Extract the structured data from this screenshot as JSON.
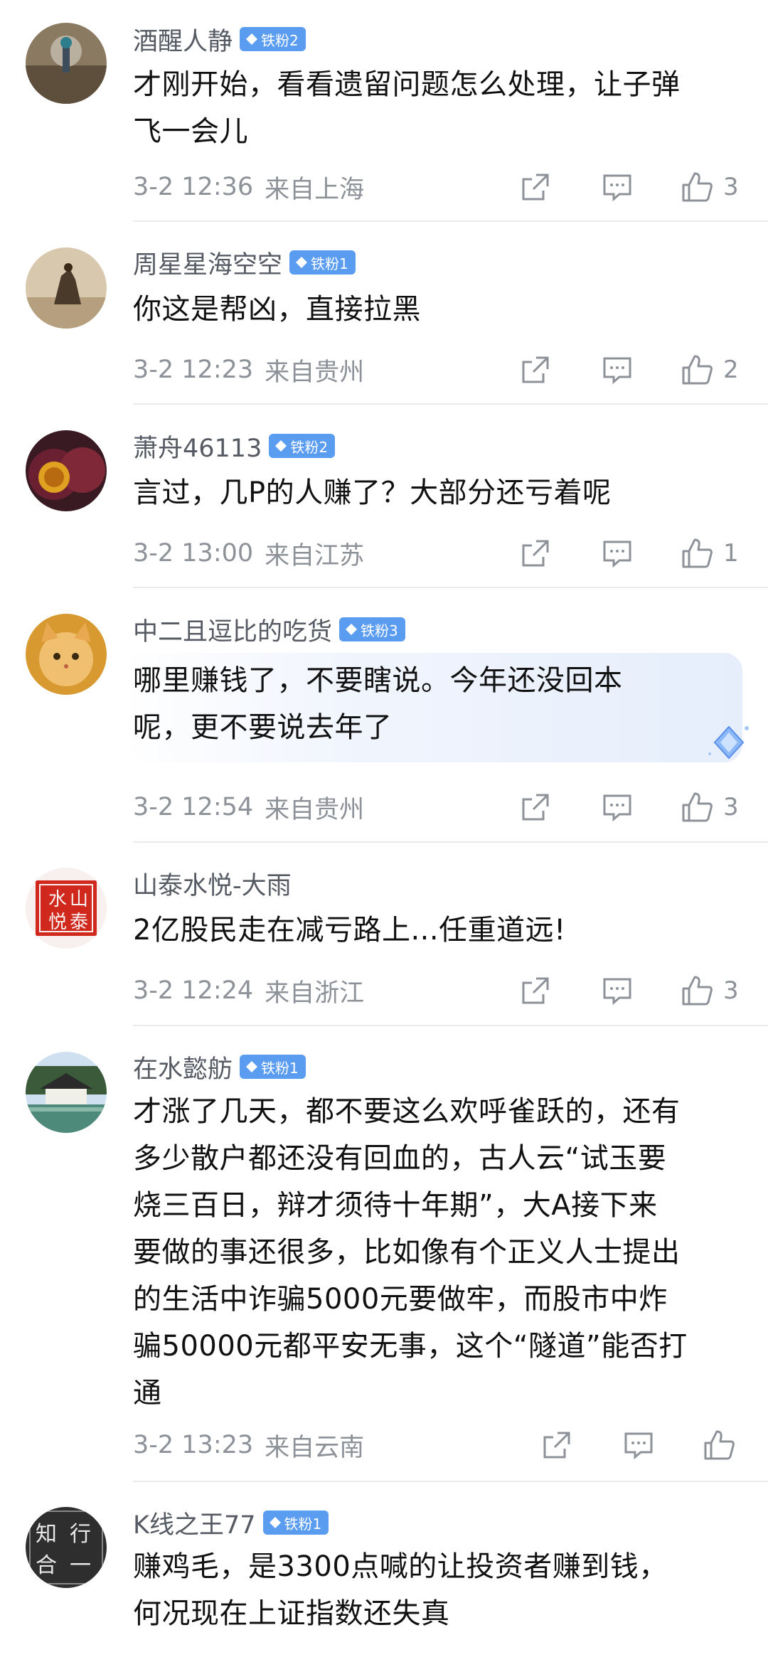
{
  "comments": [
    {
      "username": "酒醒人静",
      "badge": "铁粉2",
      "lines": [
        "才刚开始，看看遗留问题怎么处理，让子弹",
        "飞一会儿"
      ],
      "time": "3-2 12:36",
      "location": "来自上海",
      "likes": "3"
    },
    {
      "username": "周星星海空空",
      "badge": "铁粉1",
      "lines": [
        "你这是帮凶，直接拉黑"
      ],
      "time": "3-2 12:23",
      "location": "来自贵州",
      "likes": "2"
    },
    {
      "username": "萧舟46113",
      "badge": "铁粉2",
      "lines": [
        "言过，几P的人赚了？大部分还亏着呢"
      ],
      "time": "3-2 13:00",
      "location": "来自江苏",
      "likes": "1"
    },
    {
      "username": "中二且逗比的吃货",
      "badge": "铁粉3",
      "lines": [
        "哪里赚钱了，不要瞎说。今年还没回本",
        "呢，更不要说去年了"
      ],
      "time": "3-2 12:54",
      "location": "来自贵州",
      "likes": "3"
    },
    {
      "username": "山泰水悦-大雨",
      "badge": "",
      "lines": [
        "2亿股民走在减亏路上...任重道远!"
      ],
      "time": "3-2 12:24",
      "location": "来自浙江",
      "likes": "3"
    },
    {
      "username": "在水懿舫",
      "badge": "铁粉1",
      "lines": [
        "才涨了几天，都不要这么欢呼雀跃的，还有",
        "多少散户都还没有回血的，古人云“试玉要",
        "烧三百日，辩才须待十年期”，大A接下来",
        "要做的事还很多，比如像有个正义人士提出",
        "的生活中诈骗5000元要做牢，而股市中炸",
        "骗50000元都平安无事，这个“隧道”能否打",
        "通"
      ],
      "time": "3-2 13:23",
      "location": "来自云南",
      "likes": ""
    },
    {
      "username": "K线之王77",
      "badge": "铁粉1",
      "lines": [
        "赚鸡毛，是3300点喊的让投资者赚到钱，",
        "何况现在上证指数还失真"
      ],
      "time": "",
      "location": "",
      "likes": ""
    }
  ],
  "avatar_texts": {
    "shantai": [
      "水",
      "山",
      "悦",
      "泰"
    ],
    "kxian": [
      "知",
      "行",
      "合",
      "一"
    ]
  },
  "colors": {
    "badge": "#5a9cf0",
    "meta": "#8d9299",
    "username": "#555a63"
  }
}
